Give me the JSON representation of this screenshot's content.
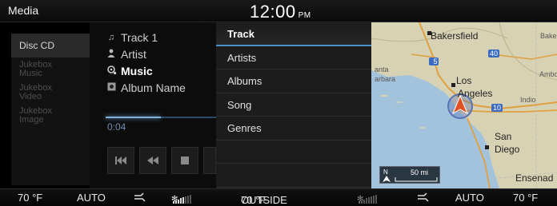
{
  "header": {
    "mode": "Media",
    "time": "12:00",
    "ampm": "PM"
  },
  "sources": [
    {
      "label": "Disc CD",
      "active": true
    },
    {
      "label": "Jukebox Music",
      "line1": "Jukebox",
      "line2": "Music",
      "active": false
    },
    {
      "label": "Jukebox Video",
      "line1": "Jukebox",
      "line2": "Video",
      "active": false
    },
    {
      "label": "Jukebox Image",
      "line1": "Jukebox",
      "line2": "Image",
      "active": false
    }
  ],
  "player": {
    "track": "Track 1",
    "artist": "Artist",
    "genre": "Music",
    "album": "Album Name",
    "elapsed": "0:04",
    "progress": 0.5,
    "track_icon": "music-note-icon",
    "artist_icon": "person-icon",
    "genre_icon": "genre-icon",
    "album_icon": "album-icon"
  },
  "controls": [
    {
      "name": "previous-track-icon",
      "glyph": "⏮"
    },
    {
      "name": "rewind-icon",
      "glyph": "⏪"
    },
    {
      "name": "stop-icon",
      "glyph": "■"
    },
    {
      "name": "play-icon",
      "glyph": ""
    }
  ],
  "categories": [
    {
      "label": "Track",
      "selected": true
    },
    {
      "label": "Artists",
      "selected": false
    },
    {
      "label": "Albums",
      "selected": false
    },
    {
      "label": "Song",
      "selected": false
    },
    {
      "label": "Genres",
      "selected": false
    },
    {
      "label": "",
      "selected": false
    },
    {
      "label": "",
      "selected": false
    }
  ],
  "map": {
    "cities": {
      "bakersfield": "Bakersfield",
      "baker": "Baker",
      "barbara": "arbara",
      "anta": "anta",
      "los": "Los",
      "angeles": "Angeles",
      "amboy": "Ambo",
      "indio": "Indio",
      "san": "San",
      "diego": "Diego",
      "ensenada": "Ensenad"
    },
    "highways": [
      "5",
      "40",
      "10"
    ],
    "scale": "50 mi",
    "north": "N"
  },
  "climate": {
    "left_temp": "70 °F",
    "left_mode": "AUTO",
    "outside_label": "OUTSIDE",
    "outside_temp": "70 °F",
    "right_mode": "AUTO",
    "right_temp": "70 °F",
    "left_fan_level": 5,
    "right_fan_level": 1
  },
  "colors": {
    "accent": "#4a90c8",
    "ocean": "#a3c3dd",
    "land": "#d7d2b4"
  }
}
